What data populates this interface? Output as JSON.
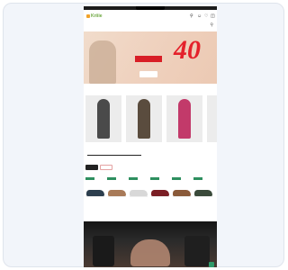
{
  "header": {
    "logo_text": "Kriiie",
    "icons": [
      "search-icon",
      "user-icon",
      "heart-icon",
      "cart-icon"
    ]
  },
  "hero": {
    "small_text": "",
    "big_number": "40",
    "red_label": "",
    "cta_label": ""
  },
  "section": {
    "title": ""
  },
  "carousel": {
    "cards": [
      {
        "title": "",
        "subtitle": ""
      },
      {
        "title": "",
        "subtitle": ""
      },
      {
        "title": "",
        "subtitle": ""
      },
      {
        "title": "",
        "subtitle": ""
      }
    ]
  },
  "tabs": {
    "active": "",
    "inactive": ""
  },
  "products_row": {
    "title": "",
    "items": [
      {
        "name": "",
        "price": ""
      },
      {
        "name": "",
        "price": ""
      },
      {
        "name": "",
        "price": ""
      },
      {
        "name": "",
        "price": ""
      },
      {
        "name": "",
        "price": ""
      },
      {
        "name": "",
        "price": ""
      }
    ]
  },
  "dark_section": {
    "title": ""
  },
  "colors": {
    "accent_green": "#2e8f5f",
    "sale_red": "#d81e26",
    "brand_green": "#6aa63d"
  }
}
